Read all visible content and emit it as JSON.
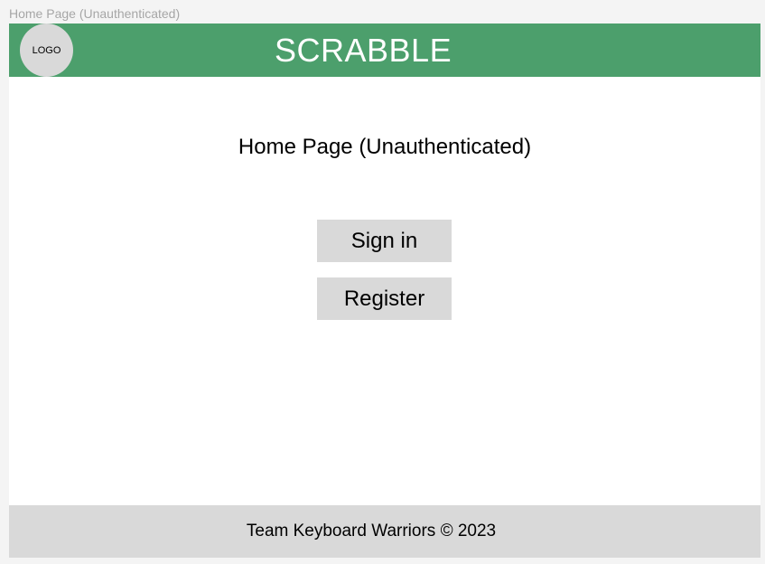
{
  "frame": {
    "label": "Home Page (Unauthenticated)"
  },
  "header": {
    "logo_text": "LOGO",
    "app_title": "SCRABBLE",
    "background_color": "#4c9f6c"
  },
  "main": {
    "page_title": "Home Page (Unauthenticated)",
    "sign_in_label": "Sign in",
    "register_label": "Register"
  },
  "footer": {
    "text": "Team Keyboard Warriors © 2023"
  }
}
